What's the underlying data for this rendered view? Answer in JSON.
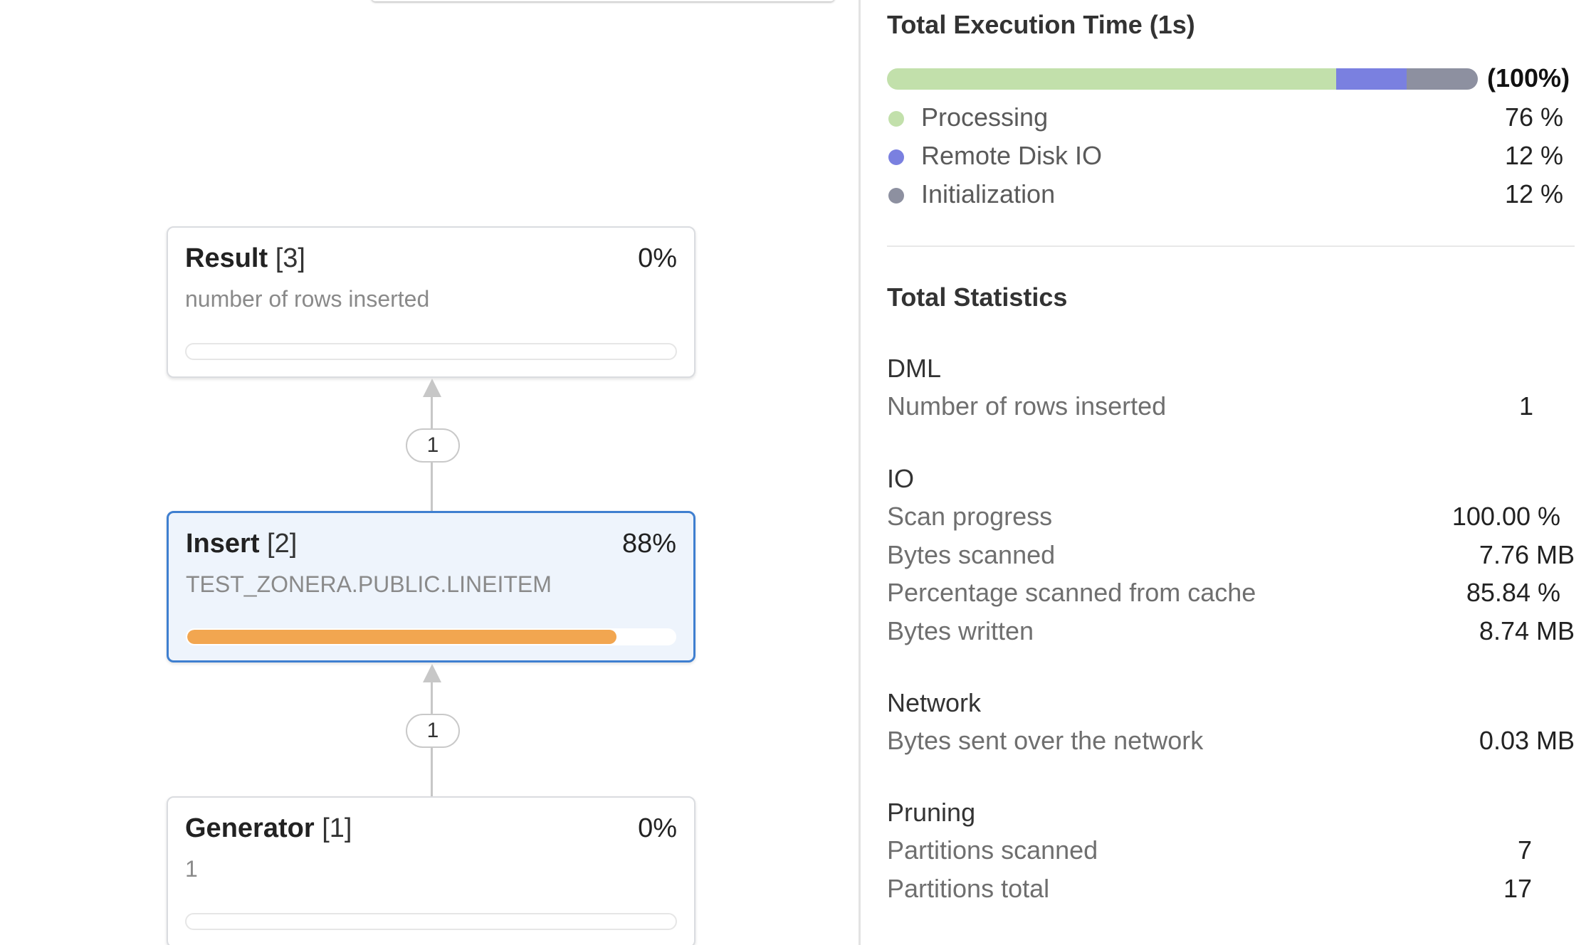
{
  "graph": {
    "nodes": [
      {
        "name": "Result",
        "index": "[3]",
        "percent": "0%",
        "subtitle": "number of rows inserted",
        "progress": 0
      },
      {
        "name": "Insert",
        "index": "[2]",
        "percent": "88%",
        "subtitle": "TEST_ZONERA.PUBLIC.LINEITEM",
        "progress": 0.88
      },
      {
        "name": "Generator",
        "index": "[1]",
        "percent": "0%",
        "subtitle": "1",
        "progress": 0
      }
    ],
    "edges": [
      {
        "label": "1"
      },
      {
        "label": "1"
      }
    ]
  },
  "execution": {
    "title": "Total Execution Time (1s)",
    "total": "(100%)",
    "segments": [
      {
        "label": "Processing",
        "value": "76 %",
        "fraction": 0.76,
        "color": "#c2e0ab"
      },
      {
        "label": "Remote Disk IO",
        "value": "12 %",
        "fraction": 0.12,
        "color": "#7a80e0"
      },
      {
        "label": "Initialization",
        "value": "12 %",
        "fraction": 0.12,
        "color": "#8d90a0"
      }
    ]
  },
  "stats": {
    "title": "Total Statistics",
    "groups": [
      {
        "title": "DML",
        "rows": [
          {
            "label": "Number of rows inserted",
            "value": "1"
          }
        ]
      },
      {
        "title": "IO",
        "rows": [
          {
            "label": "Scan progress",
            "value": "100.00 %"
          },
          {
            "label": "Bytes scanned",
            "value": "7.76 MB"
          },
          {
            "label": "Percentage scanned from cache",
            "value": "85.84 %"
          },
          {
            "label": "Bytes written",
            "value": "8.74 MB"
          }
        ]
      },
      {
        "title": "Network",
        "rows": [
          {
            "label": "Bytes sent over the network",
            "value": "0.03 MB"
          }
        ]
      },
      {
        "title": "Pruning",
        "rows": [
          {
            "label": "Partitions scanned",
            "value": "7"
          },
          {
            "label": "Partitions total",
            "value": "17"
          }
        ]
      }
    ]
  }
}
